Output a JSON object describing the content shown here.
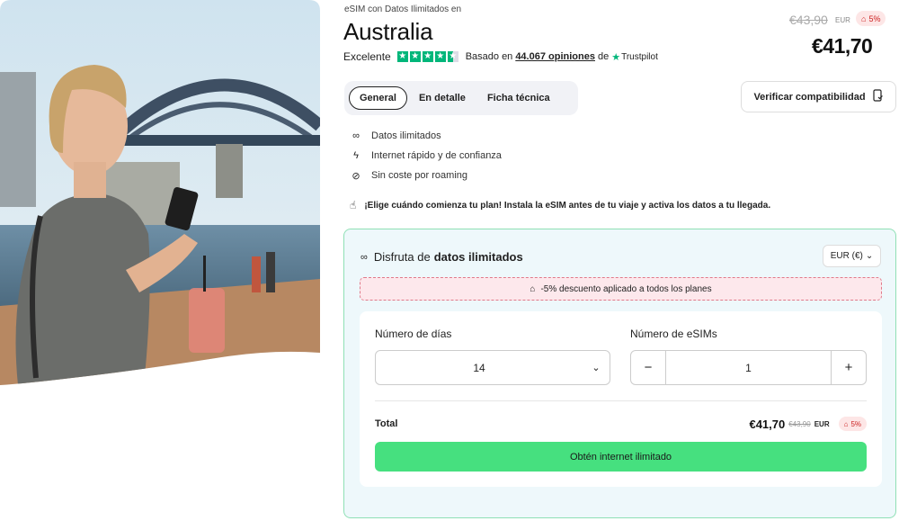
{
  "product": {
    "category": "eSIM con Datos Ilimitados en",
    "title": "Australia"
  },
  "rating": {
    "label": "Excelente",
    "stars": 4.5,
    "based_on_prefix": "Basado en",
    "count": "44.067 opiniones",
    "of": "de",
    "source": "Trustpilot"
  },
  "price": {
    "old": "€43,90",
    "currency": "EUR",
    "discount": "5%",
    "current": "€41,70"
  },
  "tabs": [
    {
      "label": "General",
      "active": true
    },
    {
      "label": "En detalle",
      "active": false
    },
    {
      "label": "Ficha técnica",
      "active": false
    }
  ],
  "verify_button": {
    "label": "Verificar compatibilidad",
    "icon": "phone-check-icon"
  },
  "features": [
    {
      "icon": "infinity-icon",
      "label": "Datos ilimitados"
    },
    {
      "icon": "lightning-icon",
      "label": "Internet rápido y de confianza"
    },
    {
      "icon": "no-roaming-icon",
      "label": "Sin coste por roaming"
    }
  ],
  "notice": {
    "icon": "hand-tap-icon",
    "text": "¡Elige cuándo comienza tu plan! Instala la eSIM antes de tu viaje y activa los datos a tu llegada."
  },
  "plan": {
    "heading_prefix": "Disfruta de",
    "heading_bold": "datos ilimitados",
    "currency_select": "EUR (€)",
    "discount_notice": "-5% descuento aplicado a todos los planes",
    "days_label": "Número de días",
    "days_value": "14",
    "esims_label": "Número de eSIMs",
    "esims_value": "1",
    "total_label": "Total",
    "total_price": "€41,70",
    "total_old": "€43,90",
    "total_currency": "EUR",
    "total_discount": "5%",
    "cta": "Obtén internet ilimitado"
  },
  "colors": {
    "accent_green": "#46e07f",
    "trustpilot_green": "#00b67a",
    "discount_red": "#cc2222",
    "card_border": "#8fe0b5",
    "card_bg": "#eef8fb"
  }
}
